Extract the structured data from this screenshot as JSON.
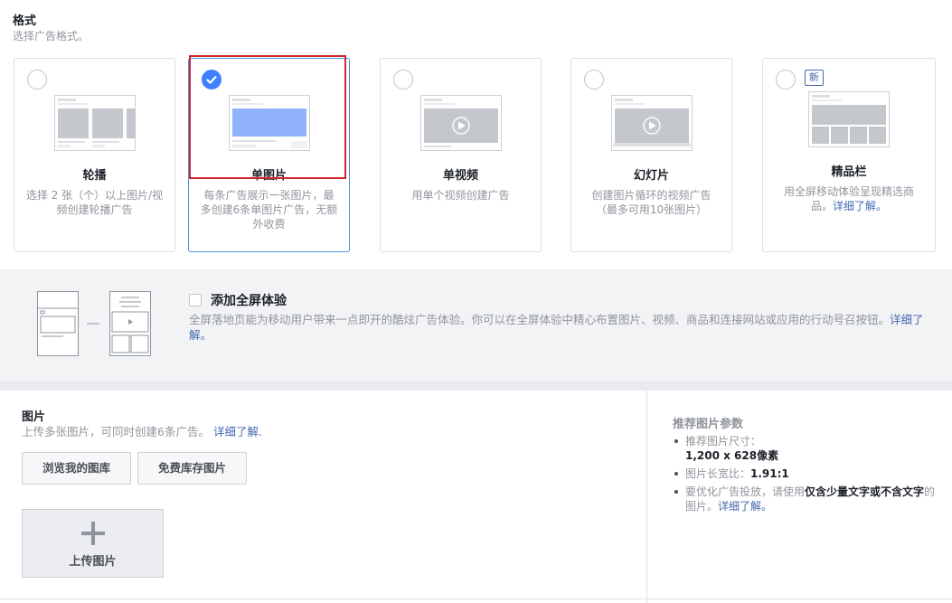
{
  "format": {
    "title": "格式",
    "subtitle": "选择广告格式。"
  },
  "cards": [
    {
      "title": "轮播",
      "desc": "选择 2 张（个）以上图片/视频创建轮播广告",
      "selected": false
    },
    {
      "title": "单图片",
      "desc": "每条广告展示一张图片，最多创建6条单图片广告，无额外收费",
      "selected": true
    },
    {
      "title": "单视频",
      "desc": "用单个视频创建广告",
      "selected": false
    },
    {
      "title": "幻灯片",
      "desc": "创建图片循环的视频广告（最多可用10张图片）",
      "selected": false
    },
    {
      "title": "精品栏",
      "desc": "用全屏移动体验呈现精选商品。",
      "link": "详细了解。",
      "badge": "新",
      "selected": false
    }
  ],
  "fullscreen": {
    "title": "添加全屏体验",
    "desc": "全屏落地页能为移动用户带来一点即开的酷炫广告体验。你可以在全屏体验中精心布置图片、视频、商品和连接网站或应用的行动号召按钮。",
    "link": "详细了解。",
    "checked": false
  },
  "images": {
    "title": "图片",
    "subtitle": "上传多张图片，可同时创建6条广告。",
    "link": "详细了解.",
    "browse_button": "浏览我的图库",
    "stock_button": "免费库存图片",
    "upload_label": "上传图片"
  },
  "recommend": {
    "title": "推荐图片参数",
    "size_label": "推荐图片尺寸：",
    "size_value": "1,200 x 628像素",
    "ratio_label": "图片长宽比：",
    "ratio_value": "1.91:1",
    "tip_prefix": "要优化广告投放，请使用",
    "tip_bold": "仅含少量文字或不含文字",
    "tip_suffix": "的图片。",
    "tip_link": "详细了解。"
  },
  "colors": {
    "accent": "#4080ff",
    "link": "#4267b2",
    "highlight": "#d0262c"
  }
}
